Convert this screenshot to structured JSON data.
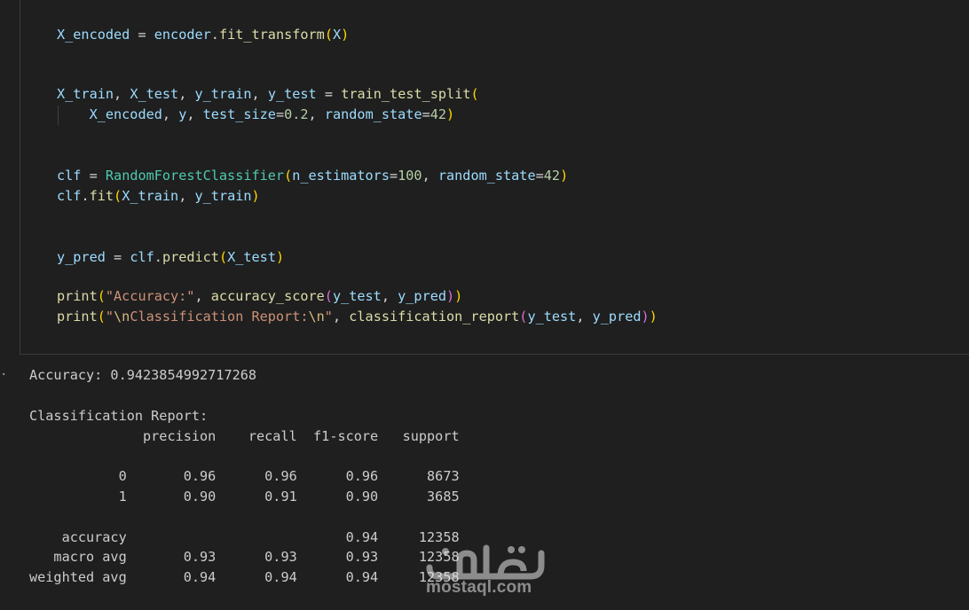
{
  "code": {
    "line_encode": "X_encoded = encoder.fit_transform(X)",
    "line_split_1": "X_train, X_test, y_train, y_test = train_test_split(",
    "line_split_2": "    X_encoded, y, test_size=0.2, random_state=42)",
    "line_clf": "clf = RandomForestClassifier(n_estimators=100, random_state=42)",
    "line_fit": "clf.fit(X_train, y_train)",
    "line_predict": "y_pred = clf.predict(X_test)",
    "line_print_acc": "print(\"Accuracy:\", accuracy_score(y_test, y_pred))",
    "line_print_report": "print(\"\\nClassification Report:\\n\", classification_report(y_test, y_pred))"
  },
  "output": {
    "marker": "·",
    "accuracy": "Accuracy: 0.9423854992717268",
    "report_title": "Classification Report:",
    "header": "              precision    recall  f1-score   support",
    "rows": [
      "           0       0.96      0.96      0.96      8673",
      "           1       0.90      0.91      0.90      3685",
      "    accuracy                           0.94     12358",
      "   macro avg       0.93      0.93      0.93     12358",
      "weighted avg       0.94      0.94      0.94     12358"
    ]
  },
  "watermark": {
    "arabic": "مستقل",
    "text": "mostaql.com"
  },
  "colors": {
    "background": "#1f1f1f",
    "variable": "#9cdcfe",
    "function": "#dcdcaa",
    "class": "#4ec9b0",
    "string": "#ce9178",
    "number": "#b5cea8",
    "bracket_1": "#ffd700",
    "bracket_2": "#da70d6"
  }
}
